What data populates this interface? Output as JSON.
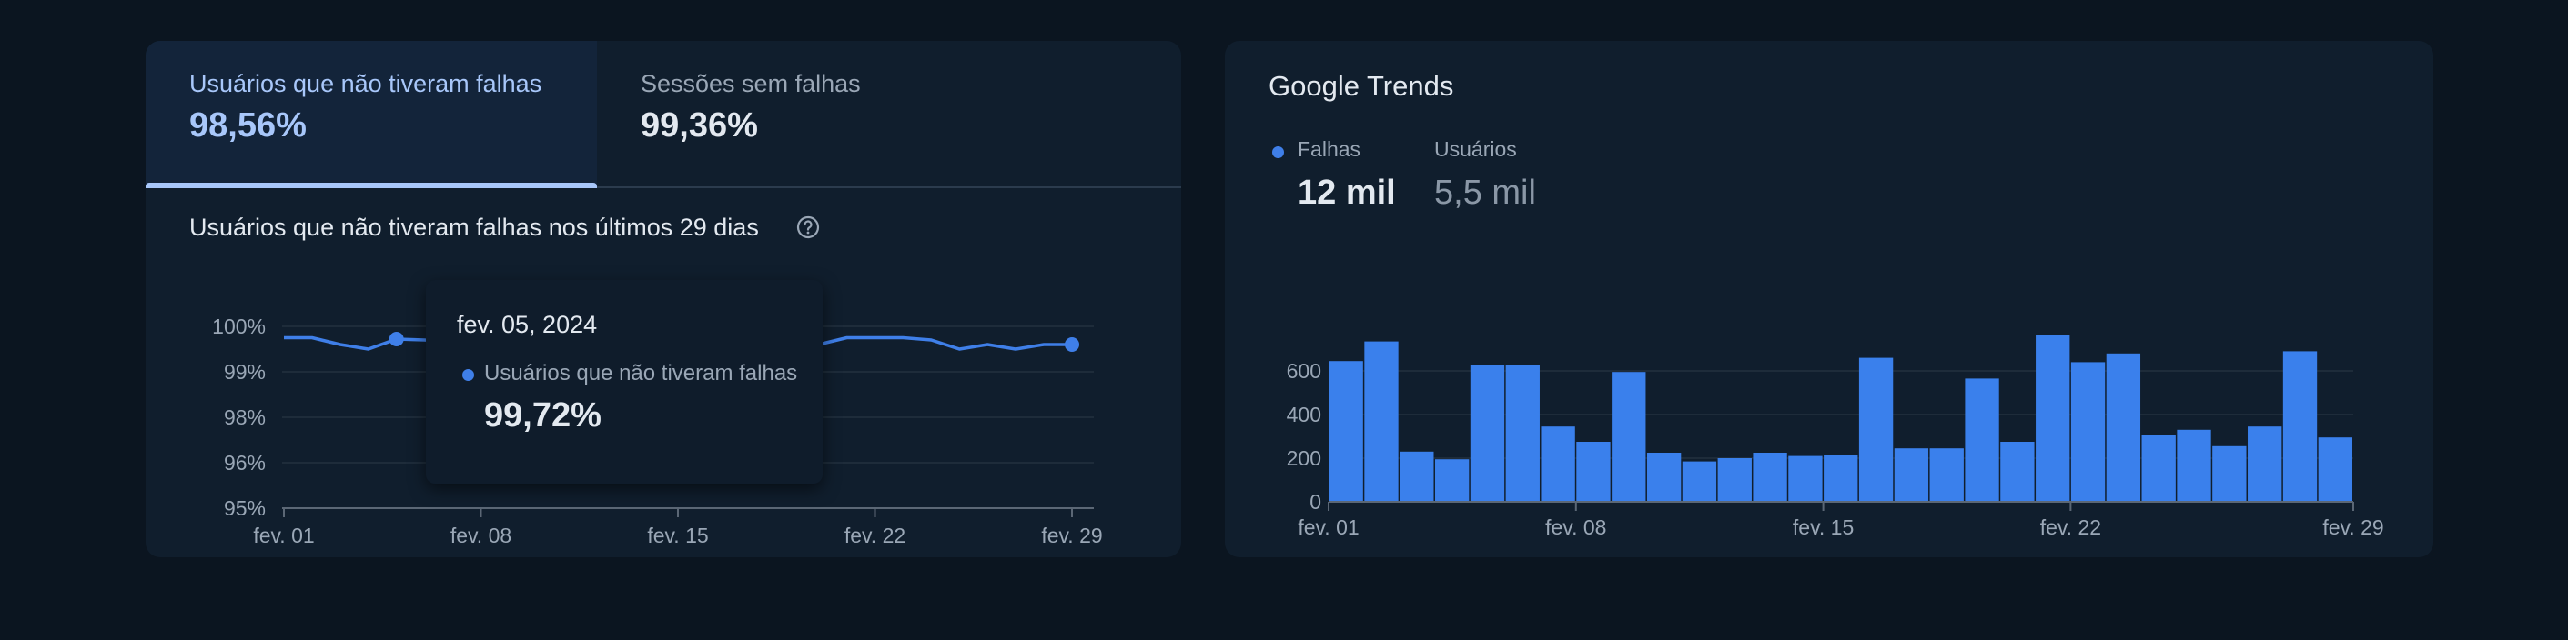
{
  "left_card": {
    "tabs": [
      {
        "label": "Usuários que não tiveram falhas",
        "value": "98,56%"
      },
      {
        "label": "Sessões sem falhas",
        "value": "99,36%"
      }
    ],
    "subtitle": "Usuários que não tiveram falhas nos últimos 29 dias",
    "tooltip": {
      "date": "fev. 05, 2024",
      "series": "Usuários que não tiveram falhas",
      "value": "99,72%"
    }
  },
  "right_card": {
    "title": "Google Trends",
    "legend": [
      {
        "label": "Falhas",
        "value": "12 mil"
      },
      {
        "label": "Usuários",
        "value": "5,5 mil"
      }
    ]
  },
  "colors": {
    "accent": "#a8c7fa",
    "series_blue": "#3f7fe8",
    "bar_blue": "#3a80ec",
    "card_bg": "#101e2d",
    "page_bg": "#0b1520"
  },
  "icons": [
    "help-circle-icon"
  ],
  "chart_data": [
    {
      "type": "line",
      "title": "",
      "series": [
        {
          "name": "Usuários que não tiveram falhas",
          "values": [
            99.75,
            99.75,
            99.6,
            99.5,
            99.72,
            99.7,
            99.65,
            99.6,
            99.6,
            99.6,
            99.6,
            99.62,
            99.6,
            99.6,
            99.62,
            99.6,
            99.62,
            99.6,
            99.62,
            99.6,
            99.75,
            99.75,
            99.75,
            99.7,
            99.5,
            99.6,
            99.5,
            99.6,
            99.6
          ]
        }
      ],
      "x": [
        "fev. 01",
        "fev. 02",
        "fev. 03",
        "fev. 04",
        "fev. 05",
        "fev. 06",
        "fev. 07",
        "fev. 08",
        "fev. 09",
        "fev. 10",
        "fev. 11",
        "fev. 12",
        "fev. 13",
        "fev. 14",
        "fev. 15",
        "fev. 16",
        "fev. 17",
        "fev. 18",
        "fev. 19",
        "fev. 20",
        "fev. 21",
        "fev. 22",
        "fev. 23",
        "fev. 24",
        "fev. 25",
        "fev. 26",
        "fev. 27",
        "fev. 28",
        "fev. 29"
      ],
      "x_tick_labels": [
        "fev. 01",
        "fev. 08",
        "fev. 15",
        "fev. 22",
        "fev. 29"
      ],
      "y_tick_labels": [
        "100%",
        "99%",
        "98%",
        "96%",
        "95%"
      ],
      "highlighted_points": [
        "fev. 05",
        "fev. 29"
      ],
      "grid": true
    },
    {
      "type": "bar",
      "title": "",
      "x": [
        "fev. 01",
        "fev. 02",
        "fev. 03",
        "fev. 04",
        "fev. 05",
        "fev. 06",
        "fev. 07",
        "fev. 08",
        "fev. 09",
        "fev. 10",
        "fev. 11",
        "fev. 12",
        "fev. 13",
        "fev. 14",
        "fev. 15",
        "fev. 16",
        "fev. 17",
        "fev. 18",
        "fev. 19",
        "fev. 20",
        "fev. 21",
        "fev. 22",
        "fev. 23",
        "fev. 24",
        "fev. 25",
        "fev. 26",
        "fev. 27",
        "fev. 28",
        "fev. 29"
      ],
      "series": [
        {
          "name": "Falhas",
          "values": [
            645,
            735,
            230,
            195,
            625,
            625,
            345,
            275,
            595,
            225,
            185,
            200,
            225,
            210,
            215,
            660,
            245,
            245,
            565,
            275,
            765,
            640,
            680,
            305,
            330,
            255,
            345,
            690,
            295
          ]
        }
      ],
      "x_tick_labels": [
        "fev. 01",
        "fev. 08",
        "fev. 15",
        "fev. 22",
        "fev. 29"
      ],
      "y_ticks": [
        0,
        200,
        400,
        600
      ],
      "ylim": [
        0,
        800
      ],
      "grid": true
    }
  ]
}
